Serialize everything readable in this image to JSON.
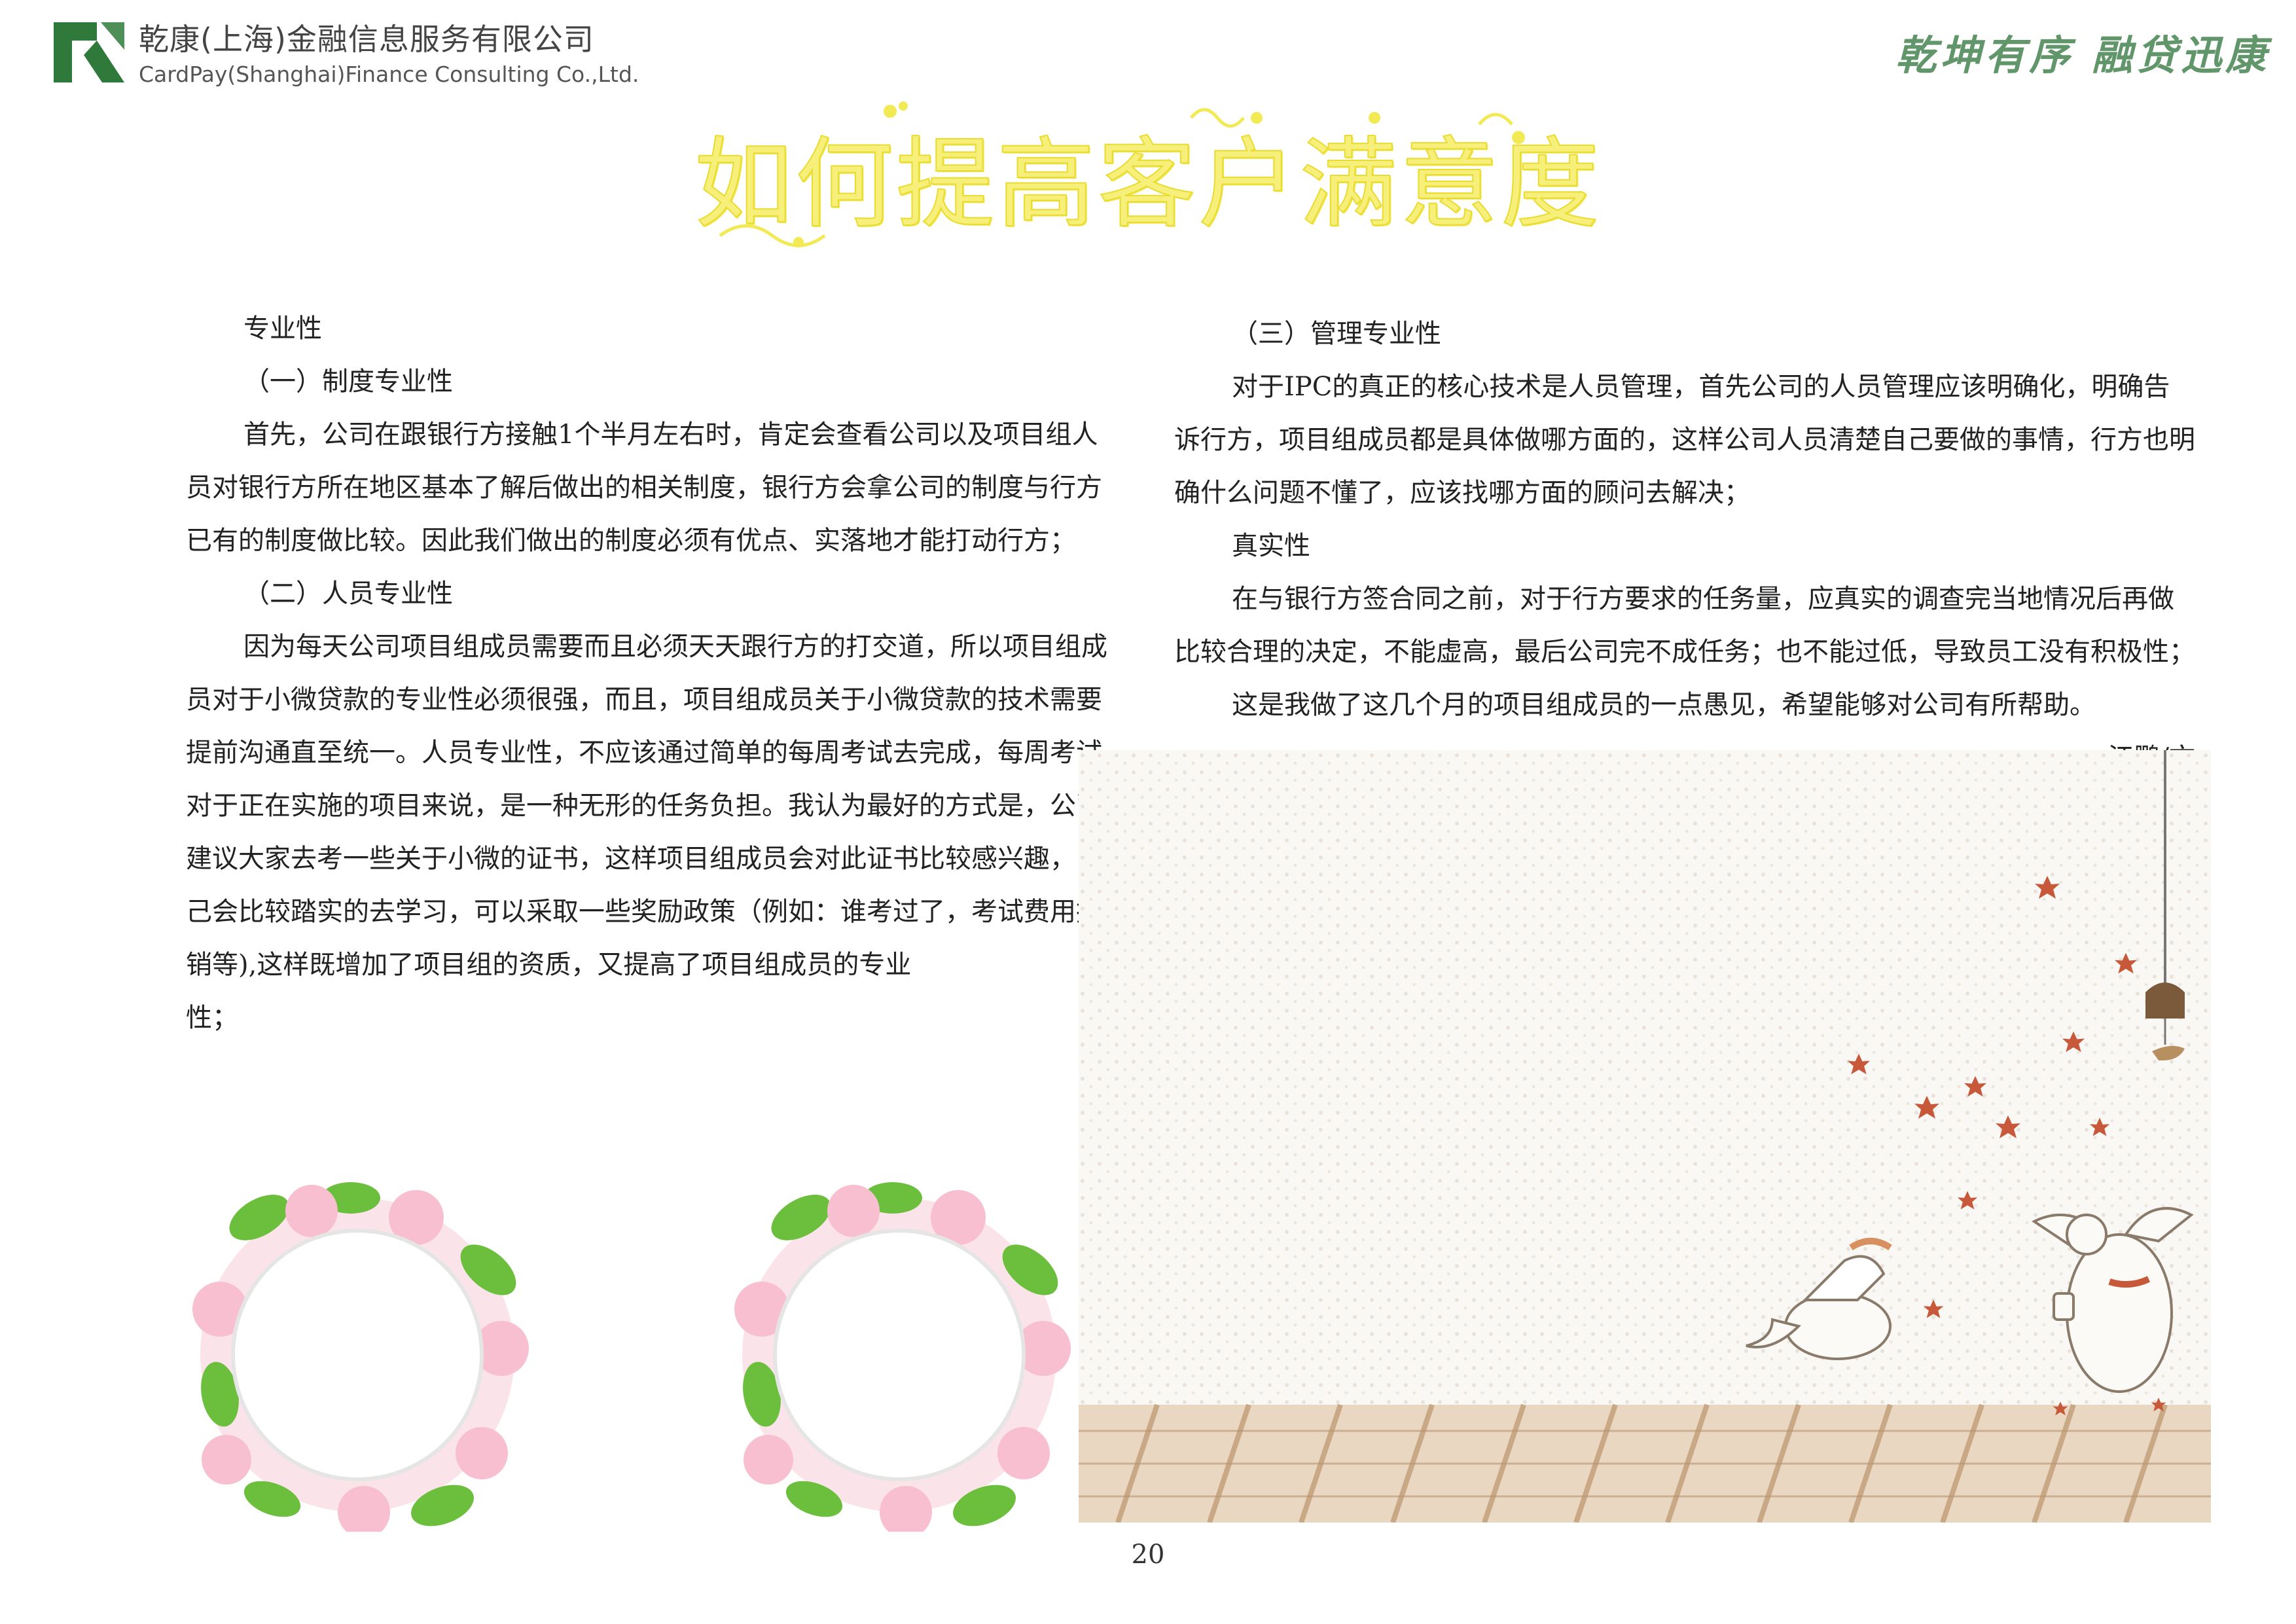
{
  "header": {
    "company_cn": "乾康(上海)金融信息服务有限公司",
    "company_en": "CardPay(Shanghai)Finance Consulting Co.,Ltd.",
    "slogan": "乾坤有序 融贷迅康",
    "brand_color": "#2f7a3a"
  },
  "title": "如何提高客户满意度",
  "left_column": {
    "p1": "专业性",
    "p2": "（一）制度专业性",
    "p3": "首先，公司在跟银行方接触1个半月左右时，肯定会查看公司以及项目组人员对银行方所在地区基本了解后做出的相关制度，银行方会拿公司的制度与行方已有的制度做比较。因此我们做出的制度必须有优点、实落地才能打动行方；",
    "p4": "（二）人员专业性",
    "p5": "因为每天公司项目组成员需要而且必须天天跟行方的打交道，所以项目组成员对于小微贷款的专业性必须很强，而且，项目组成员关于小微贷款的技术需要提前沟通直至统一。人员专业性，不应该通过简单的每周考试去完成，每周考试对于正在实施的项目来说，是一种无形的任务负担。我认为最好的方式是，公司建议大家去考一些关于小微的证书，这样项目组成员会对此证书比较感兴趣，自己会比较踏实的去学习，可以采取一些奖励政策（例如：谁考过了，考试费用报销等),这样既增加了项目组的资质，又提高了项目组成员的专业",
    "p6": "性；"
  },
  "right_column": {
    "p1": "（三）管理专业性",
    "p2": "对于IPC的真正的核心技术是人员管理，首先公司的人员管理应该明确化，明确告诉行方，项目组成员都是具体做哪方面的，这样公司人员清楚自己要做的事情，行方也明确什么问题不懂了，应该找哪方面的顾问去解决；",
    "p3": "真实性",
    "p4": "在与银行方签合同之前，对于行方要求的任务量，应真实的调查完当地情况后再做比较合理的决定，不能虚高，最后公司完不成任务；也不能过低，导致员工没有积极性；",
    "p5": "这是我做了这几个月的项目组成员的一点愚见，希望能够对公司有所帮助。",
    "signature": "江鹏/文"
  },
  "page_number": "20",
  "colors": {
    "title": "#f6f07a",
    "slogan": "#4f8b5a",
    "leaf": "#c8583a"
  }
}
